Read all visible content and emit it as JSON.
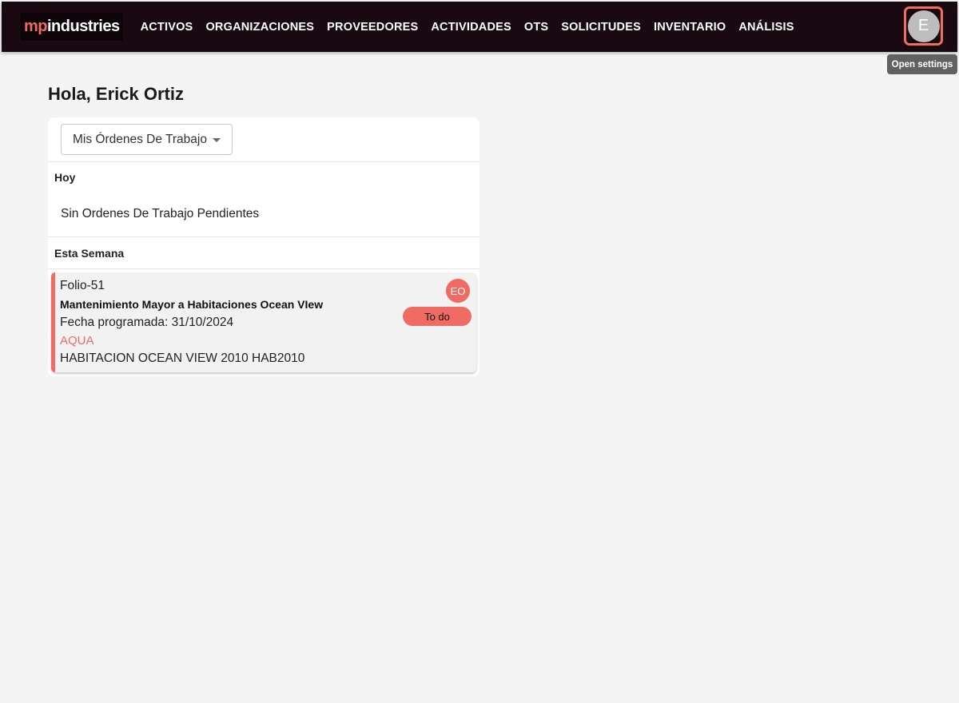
{
  "header": {
    "logo": {
      "part1": "mp",
      "part2": "industries"
    },
    "nav": [
      "ACTIVOS",
      "ORGANIZACIONES",
      "PROVEEDORES",
      "ACTIVIDADES",
      "OTS",
      "SOLICITUDES",
      "INVENTARIO",
      "ANÁLISIS"
    ],
    "avatar_initial": "E",
    "tooltip": "Open settings"
  },
  "main": {
    "greeting": "Hola, Erick Ortiz",
    "filter_select": {
      "value": "Mis Órdenes De Trabajo"
    },
    "sections": {
      "today": {
        "title": "Hoy",
        "empty_text": "Sin Ordenes De Trabajo Pendientes"
      },
      "week": {
        "title": "Esta Semana"
      }
    },
    "work_orders": [
      {
        "folio": "Folio-51",
        "title": "Mantenimiento Mayor a Habitaciones Ocean VIew",
        "scheduled": "Fecha programada: 31/10/2024",
        "location": "AQUA",
        "asset": "HABITACION OCEAN VIEW 2010 HAB2010",
        "assignee_initials": "EO",
        "status": "To do"
      }
    ]
  },
  "colors": {
    "topbar_bg": "#190a12",
    "accent": "#ef6b63",
    "highlight_border": "#f26d5b",
    "page_bg": "#f4f4f4"
  },
  "icons": {
    "select_caret": "caret-down-icon"
  }
}
